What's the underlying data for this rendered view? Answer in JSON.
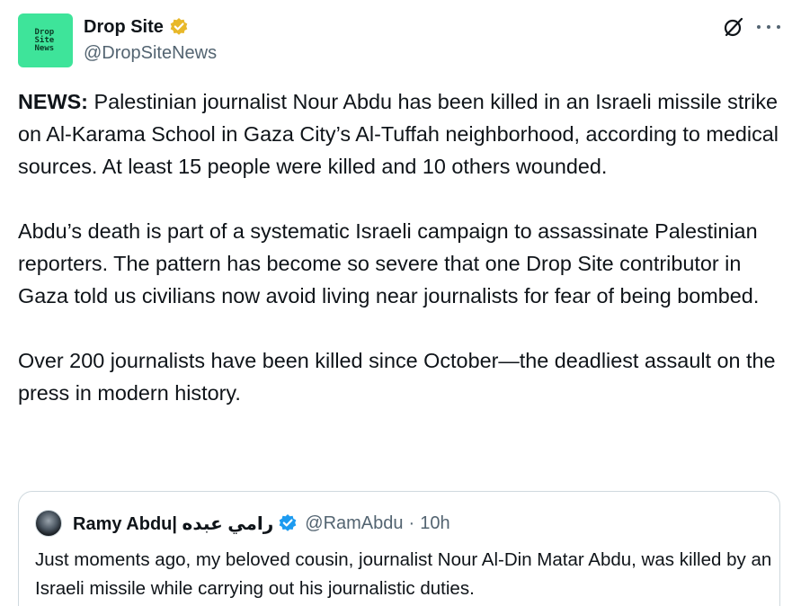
{
  "author": {
    "avatar_lines": [
      "Drop",
      "Site",
      "News"
    ],
    "display_name": "Drop Site",
    "handle": "@DropSiteNews",
    "badge_color": "#e8b829",
    "avatar_color": "#3ee49a"
  },
  "actions": {
    "grok_icon": "grok-icon",
    "more_icon": "more-icon"
  },
  "post": {
    "lead": "NEWS:",
    "paragraph1": " Palestinian journalist Nour Abdu has been killed in an Israeli missile strike on Al-Karama School in Gaza City’s Al-Tuffah neighborhood, according to medical sources. At least 15 people were killed and 10 others wounded.",
    "paragraph2": "Abdu’s death is part of a systematic Israeli campaign to assassinate Palestinian reporters. The pattern has become so severe that one Drop Site contributor in Gaza told us civilians now avoid living near journalists for fear of being bombed.",
    "paragraph3": "Over 200 journalists have been  killed since October—the deadliest assault on the press in modern history."
  },
  "quoted": {
    "display_name": "Ramy Abdu| رامي عبده",
    "handle": "@RamAbdu",
    "separator": "·",
    "time": "10h",
    "badge_color": "#1d9bf0",
    "text": "Just moments ago, my beloved cousin, journalist Nour Al-Din Matar Abdu, was killed by an Israeli missile while carrying out his journalistic duties."
  }
}
